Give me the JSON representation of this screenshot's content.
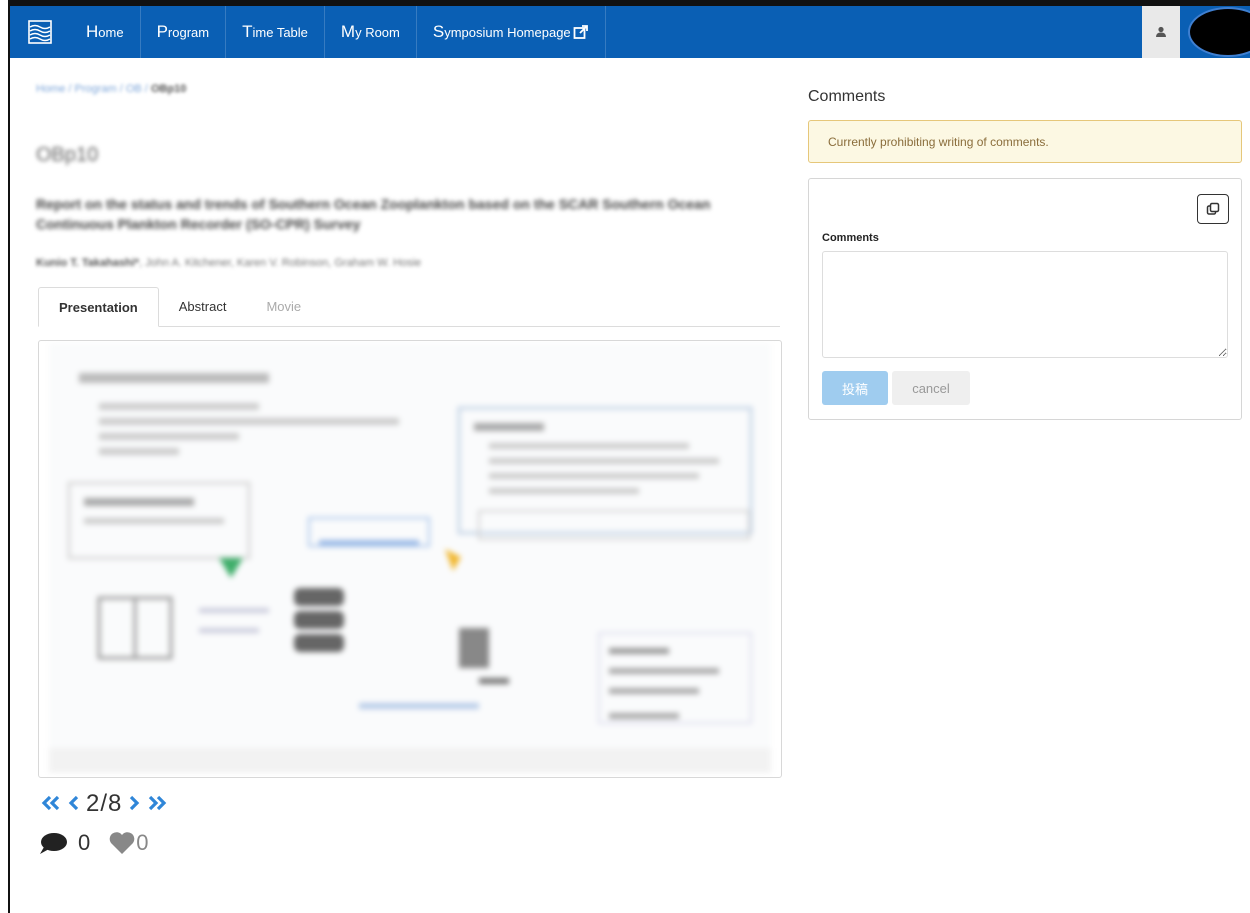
{
  "nav": {
    "items": [
      {
        "cap": "H",
        "rest": "ome"
      },
      {
        "cap": "P",
        "rest": "rogram"
      },
      {
        "cap": "T",
        "rest": "ime Table"
      },
      {
        "cap": "M",
        "rest": "y Room"
      },
      {
        "cap": "S",
        "rest": "ymposium Homepage"
      }
    ],
    "brand_color": "#0a5fb4"
  },
  "breadcrumb": {
    "path": "Home / Program / OB /",
    "current": "OBp10"
  },
  "paper": {
    "code": "OBp10",
    "title": "Report on the status and trends of Southern Ocean Zooplankton based on the SCAR Southern Ocean Continuous Plankton Recorder (SO-CPR) Survey",
    "presenter": "Kunio T. Takahashi*",
    "coauthors": ", John A. Kitchener, Karen V. Robinson, Graham W. Hosie"
  },
  "tabs": {
    "presentation": "Presentation",
    "abstract": "Abstract",
    "movie": "Movie"
  },
  "pager": {
    "current": "2",
    "sep": "/",
    "total": "8"
  },
  "stats": {
    "comments": "0",
    "likes": "0"
  },
  "comments": {
    "heading": "Comments",
    "alert": "Currently prohibiting writing of comments.",
    "field_label": "Comments",
    "submit_label": "投稿",
    "cancel_label": "cancel"
  }
}
